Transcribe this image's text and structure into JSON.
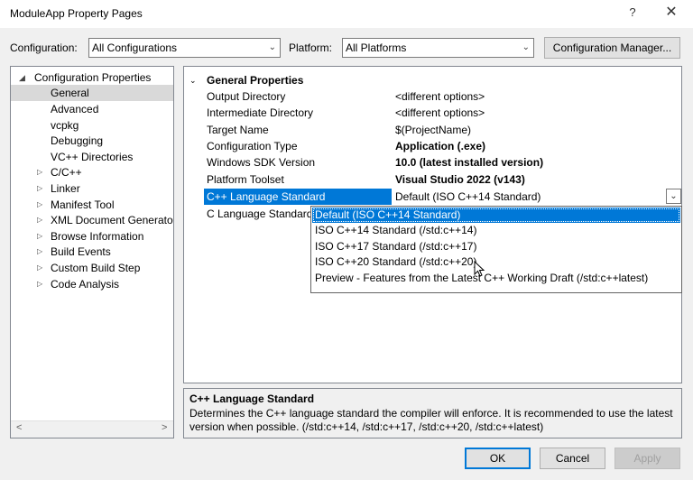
{
  "window": {
    "title": "ModuleApp Property Pages",
    "help": "?",
    "close": "✕"
  },
  "toolbar": {
    "configuration_label": "Configuration:",
    "configuration_value": "All Configurations",
    "platform_label": "Platform:",
    "platform_value": "All Platforms",
    "config_manager_label": "Configuration Manager..."
  },
  "tree": {
    "root": "Configuration Properties",
    "items": [
      {
        "label": "General"
      },
      {
        "label": "Advanced"
      },
      {
        "label": "vcpkg"
      },
      {
        "label": "Debugging"
      },
      {
        "label": "VC++ Directories"
      },
      {
        "label": "C/C++"
      },
      {
        "label": "Linker"
      },
      {
        "label": "Manifest Tool"
      },
      {
        "label": "XML Document Generator"
      },
      {
        "label": "Browse Information"
      },
      {
        "label": "Build Events"
      },
      {
        "label": "Custom Build Step"
      },
      {
        "label": "Code Analysis"
      }
    ],
    "scroll_left": "<",
    "scroll_right": ">"
  },
  "grid": {
    "category": "General Properties",
    "rows": [
      {
        "name": "Output Directory",
        "value": "<different options>"
      },
      {
        "name": "Intermediate Directory",
        "value": "<different options>"
      },
      {
        "name": "Target Name",
        "value": "$(ProjectName)"
      },
      {
        "name": "Configuration Type",
        "value": "Application (.exe)"
      },
      {
        "name": "Windows SDK Version",
        "value": "10.0 (latest installed version)"
      },
      {
        "name": "Platform Toolset",
        "value": "Visual Studio 2022 (v143)"
      },
      {
        "name": "C++ Language Standard",
        "value": "Default (ISO C++14 Standard)"
      },
      {
        "name": "C Language Standard",
        "value": ""
      }
    ]
  },
  "dropdown": {
    "options": [
      "Default (ISO C++14 Standard)",
      "ISO C++14 Standard (/std:c++14)",
      "ISO C++17 Standard (/std:c++17)",
      "ISO C++20 Standard (/std:c++20)",
      "Preview - Features from the Latest C++ Working Draft (/std:c++latest)"
    ]
  },
  "description": {
    "title": "C++ Language Standard",
    "text": "Determines the C++ language standard the compiler will enforce. It is recommended to use the latest version when possible.  (/std:c++14, /std:c++17, /std:c++20, /std:c++latest)"
  },
  "buttons": {
    "ok": "OK",
    "cancel": "Cancel",
    "apply": "Apply"
  },
  "colors": {
    "accent": "#0078d7",
    "tree_selection": "#cce8ff"
  }
}
